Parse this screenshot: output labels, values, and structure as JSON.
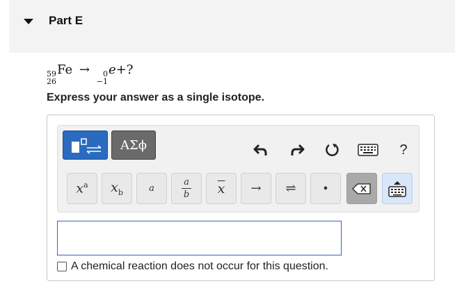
{
  "part": {
    "title": "Part E"
  },
  "question": {
    "reactant": {
      "mass": "59",
      "atomic": "26",
      "symbol": "Fe"
    },
    "arrow": "→",
    "product1": {
      "mass": "0",
      "atomic": "−1",
      "symbol": "e"
    },
    "plus_unknown": "+?",
    "instruction": "Express your answer as a single isotope."
  },
  "toolbar": {
    "mode_greek_label": "ΑΣϕ",
    "keys": [
      {
        "name": "superscript",
        "label": "xᵃ"
      },
      {
        "name": "subscript",
        "label": "x_b"
      },
      {
        "name": "isotope",
        "label": "a"
      },
      {
        "name": "fraction",
        "top": "a",
        "bottom": "b"
      },
      {
        "name": "overbar",
        "label": "x"
      },
      {
        "name": "arrow",
        "label": "→"
      },
      {
        "name": "equilibrium",
        "label": "⇌"
      },
      {
        "name": "dot",
        "label": "•"
      }
    ],
    "help_label": "?"
  },
  "answer": {
    "value": ""
  },
  "no_reaction": {
    "label": "A chemical reaction does not occur for this question.",
    "checked": false
  }
}
